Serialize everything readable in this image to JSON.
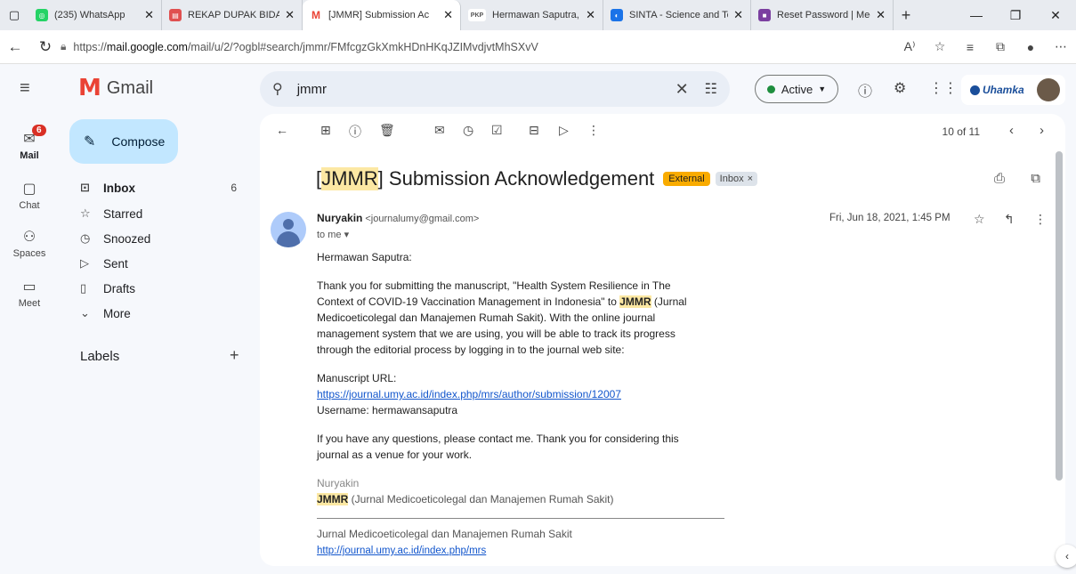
{
  "browser": {
    "tabs": [
      {
        "title": "(235) WhatsApp",
        "color": "#25d366",
        "glyph": "◎"
      },
      {
        "title": "REKAP DUPAK BIDANG",
        "color": "#e05050",
        "glyph": "▤"
      },
      {
        "title": "[JMMR] Submission Ac",
        "color": "#ea4335",
        "glyph": "M",
        "active": true
      },
      {
        "title": "Hermawan Saputra, D",
        "color": "#555555",
        "glyph": "PKP"
      },
      {
        "title": "SINTA - Science and Te",
        "color": "#1a73e8",
        "glyph": "◐"
      },
      {
        "title": "Reset Password | Medi",
        "color": "#7b3fa0",
        "glyph": "■"
      }
    ],
    "url_prefix": "https://",
    "url_host": "mail.google.com",
    "url_path": "/mail/u/2/?ogbl#search/jmmr/FMfcgzGkXmkHDnHKqJZIMvdjvtMhSXvV"
  },
  "gmail": {
    "app_name": "Gmail",
    "rail": [
      {
        "label": "Mail",
        "icon": "✉",
        "badge": "6"
      },
      {
        "label": "Chat",
        "icon": "▢"
      },
      {
        "label": "Spaces",
        "icon": "⚇"
      },
      {
        "label": "Meet",
        "icon": "▭"
      }
    ],
    "compose_label": "Compose",
    "nav": [
      {
        "label": "Inbox",
        "icon": "⊡",
        "count": "6",
        "bold": true
      },
      {
        "label": "Starred",
        "icon": "☆"
      },
      {
        "label": "Snoozed",
        "icon": "◷"
      },
      {
        "label": "Sent",
        "icon": "▷"
      },
      {
        "label": "Drafts",
        "icon": "▯"
      },
      {
        "label": "More",
        "icon": "⌄"
      }
    ],
    "labels_heading": "Labels",
    "search_value": "jmmr",
    "status": "Active",
    "org_name": "Uhamka"
  },
  "email": {
    "pager": "10 of 11",
    "subject_tag": "JMMR",
    "subject_rest": " Submission Acknowledgement",
    "chip_external": "External",
    "chip_inbox": "Inbox",
    "sender_name": "Nuryakin",
    "sender_email": "<journalumy@gmail.com>",
    "to": "to me",
    "date": "Fri, Jun 18, 2021, 1:45 PM",
    "greeting": "Hermawan Saputra:",
    "para1_a": "Thank you for submitting the manuscript, \"Health System Resilience in The Context of COVID-19 Vaccination Management in Indonesia\" to ",
    "para1_tag": "JMMR",
    "para1_b": " (Jurnal Medicoeticolegal dan Manajemen Rumah Sakit). With the online journal management system that we are using, you will be able to track its progress through the editorial process by logging in to the journal web site:",
    "manuscript_label": "Manuscript URL:",
    "manuscript_url": "https://journal.umy.ac.id/index.php/mrs/author/submission/12007",
    "username": "Username: hermawansaputra",
    "para3": "If you have any questions, please contact me. Thank you for considering this journal as a venue for your work.",
    "sig_name": "Nuryakin",
    "sig_tag": "JMMR",
    "sig_org": " (Jurnal Medicoeticolegal dan Manajemen Rumah Sakit)",
    "footer_title": "Jurnal Medicoeticolegal dan Manajemen Rumah Sakit",
    "footer_url": "http://journal.umy.ac.id/index.php/mrs"
  }
}
